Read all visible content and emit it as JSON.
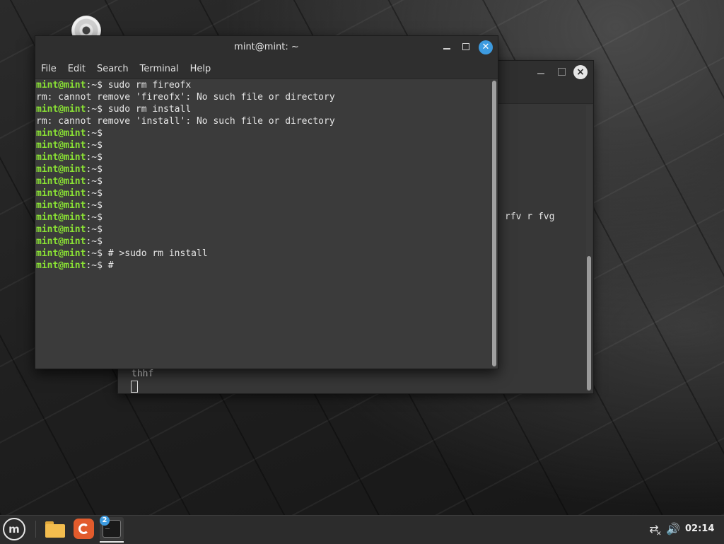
{
  "desktop": {
    "icons": [
      {
        "name": "cd-drive-icon"
      }
    ]
  },
  "back_window": {
    "partial_text": "rfv r fvg",
    "bottom_text": "thhf"
  },
  "terminal": {
    "title": "mint@mint: ~",
    "menu": [
      "File",
      "Edit",
      "Search",
      "Terminal",
      "Help"
    ],
    "prompt_user": "mint@mint",
    "prompt_suffix": ":~$",
    "lines": [
      {
        "type": "cmd",
        "text": " sudo rm fireofx"
      },
      {
        "type": "out",
        "text": "rm: cannot remove 'fireofx': No such file or directory"
      },
      {
        "type": "cmd",
        "text": " sudo rm install"
      },
      {
        "type": "out",
        "text": "rm: cannot remove 'install': No such file or directory"
      },
      {
        "type": "cmd",
        "text": ""
      },
      {
        "type": "cmd",
        "text": ""
      },
      {
        "type": "cmd",
        "text": ""
      },
      {
        "type": "cmd",
        "text": ""
      },
      {
        "type": "cmd",
        "text": ""
      },
      {
        "type": "cmd",
        "text": ""
      },
      {
        "type": "cmd",
        "text": ""
      },
      {
        "type": "cmd",
        "text": ""
      },
      {
        "type": "cmd",
        "text": ""
      },
      {
        "type": "cmd",
        "text": ""
      },
      {
        "type": "cmd",
        "text": " # >sudo rm install"
      },
      {
        "type": "cmd",
        "text": " #"
      }
    ]
  },
  "taskbar": {
    "apps": [
      {
        "name": "menu",
        "icon": "linux-mint-logo-icon"
      },
      {
        "name": "files",
        "icon": "folder-icon"
      },
      {
        "name": "firefox",
        "icon": "firefox-icon"
      },
      {
        "name": "terminal",
        "icon": "terminal-icon",
        "badge": "2"
      }
    ],
    "clock": "02:14",
    "tray_icons": [
      "network-disconnected-icon",
      "volume-icon"
    ]
  },
  "colors": {
    "prompt_green": "#8ae234",
    "accent_blue": "#3d9be0"
  }
}
